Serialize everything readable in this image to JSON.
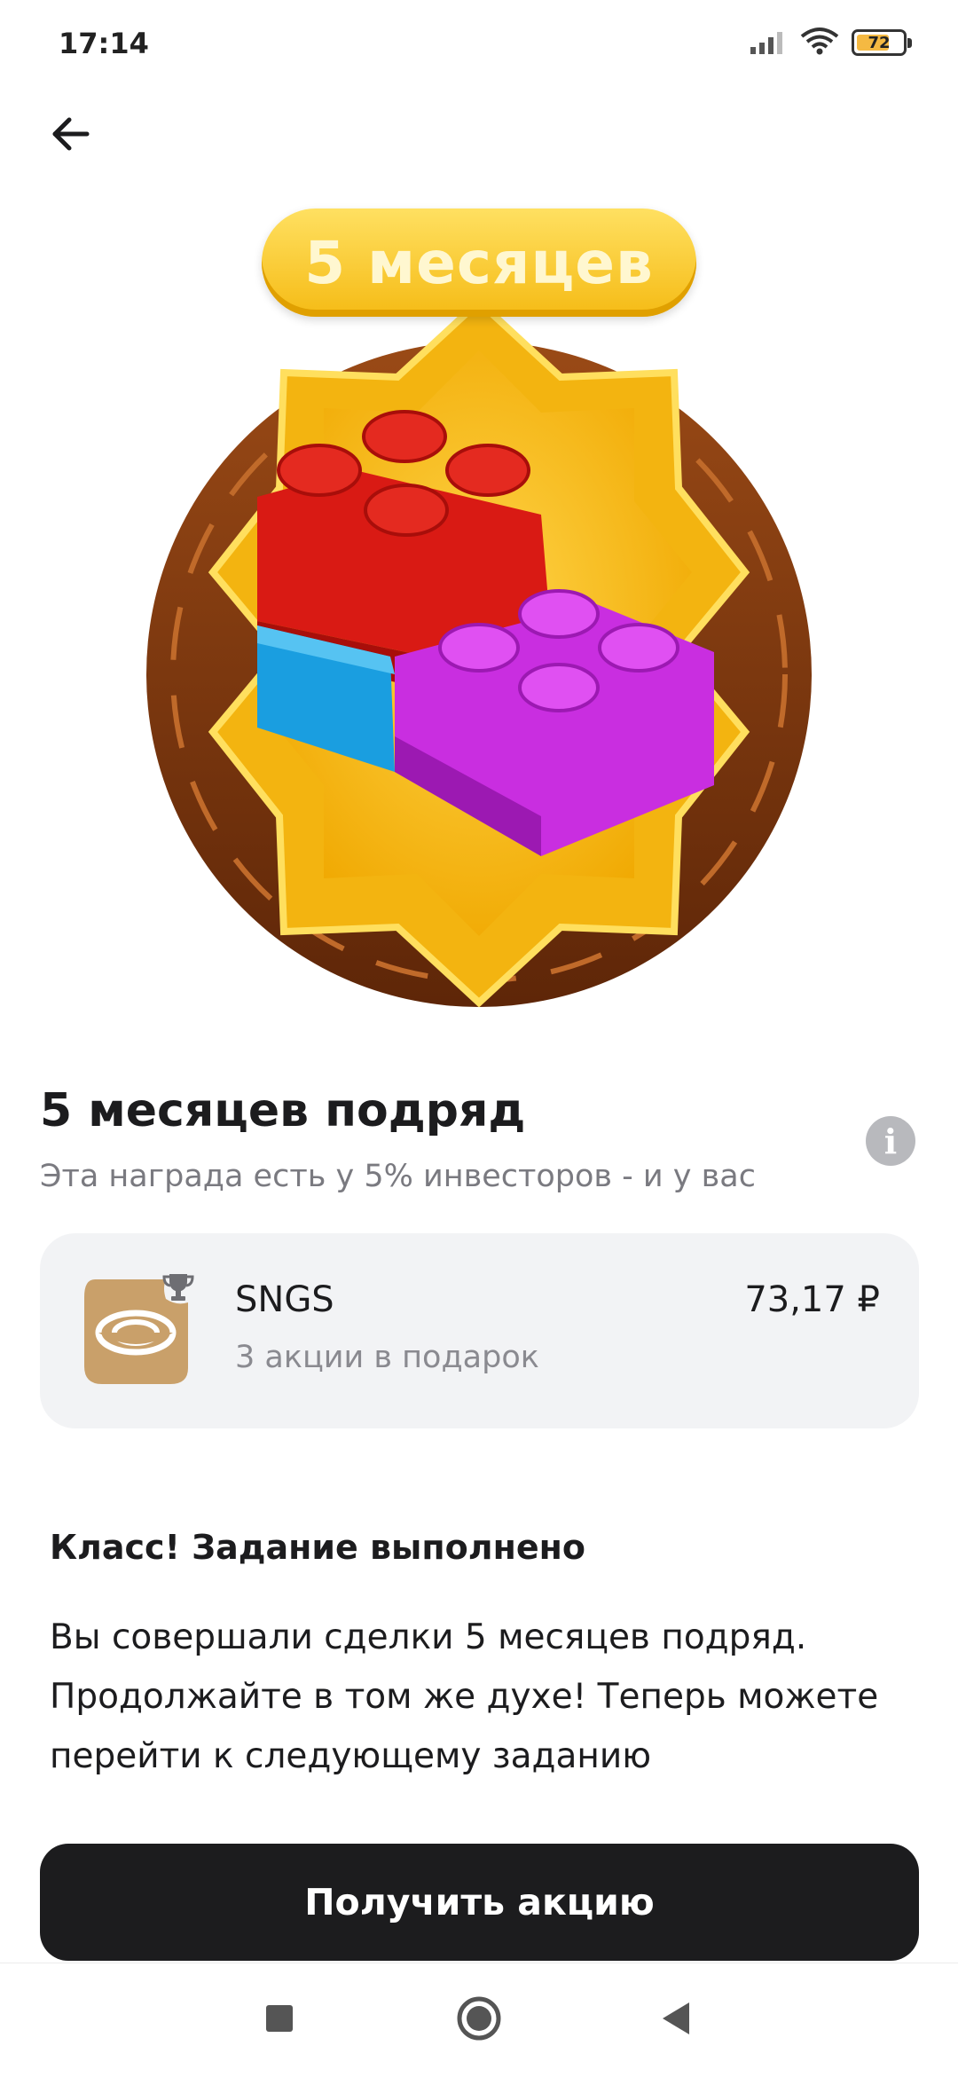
{
  "status_bar": {
    "time": "17:14",
    "battery": "72",
    "battery_level": 0.72
  },
  "award": {
    "badge_label": "5 месяцев"
  },
  "header": {
    "title": "5 месяцев подряд",
    "subtitle": "Эта награда есть у 5% инвесторов - и у вас"
  },
  "gift": {
    "ticker": "SNGS",
    "description": "3 акции в подарок",
    "price": "73,17 ₽"
  },
  "completion": {
    "title": "Класс! Задание выполнено",
    "text": "Вы совершали сделки 5 месяцев подряд. Продолжайте в том же духе! Теперь можете перейти к следующему заданию"
  },
  "cta": {
    "label": "Получить акцию"
  },
  "icons": {
    "back": "arrow-left-icon",
    "info": "info-icon",
    "trophy": "trophy-icon",
    "signal": "signal-icon",
    "wifi": "wifi-icon",
    "battery": "battery-icon",
    "nav_recents": "square-icon",
    "nav_home": "circle-icon",
    "nav_back": "triangle-back-icon"
  },
  "colors": {
    "accent_dark": "#1c1c1e",
    "card_bg": "#f2f3f5",
    "badge_gold": "#f5bb15",
    "logo_tan": "#c9a06a"
  }
}
